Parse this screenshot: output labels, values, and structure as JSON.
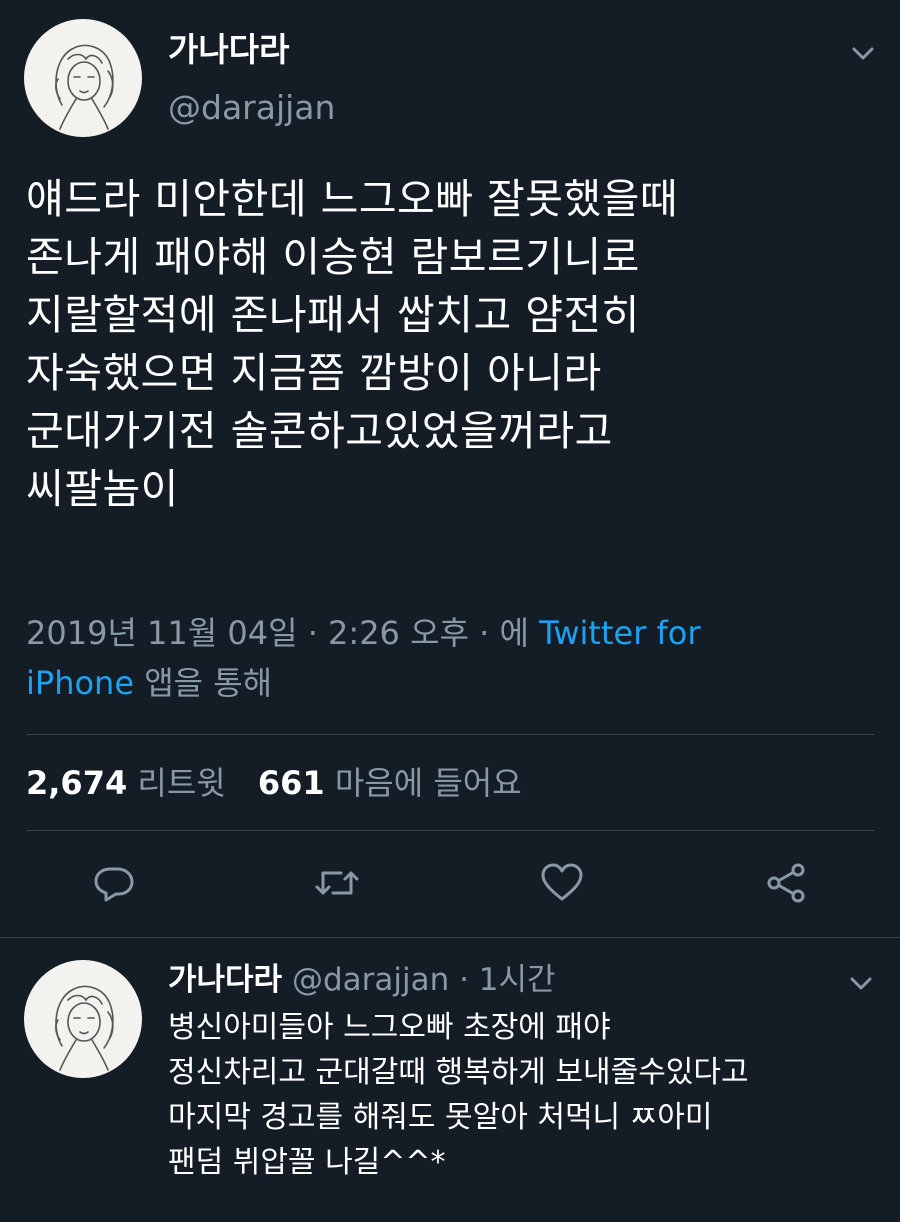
{
  "main_tweet": {
    "display_name": "가나다라",
    "handle": "@darajjan",
    "text": "얘드라 미안한데 느그오빠 잘못했을때\n존나게 패야해 이승현 람보르기니로\n지랄할적에 존나패서 쌉치고 얌전히\n자숙했으면 지금쯤 깜방이 아니라\n군대가기전 솔콘하고있었을꺼라고\n씨팔놈이",
    "meta_prefix": "2019년 11월 04일 · 2:26 오후 · 에 ",
    "source_line1": "Twitter for",
    "source_line2": "iPhone",
    "meta_suffix": " 앱을 통해",
    "retweet_count": "2,674",
    "retweet_label": "리트윗",
    "like_count": "661",
    "like_label": "마음에 들어요"
  },
  "reply": {
    "display_name": "가나다라",
    "handle_time": "@darajjan · 1시간",
    "text": "병신아미들아 느그오빠 초장에 패야\n정신차리고 군대갈때 행복하게 보내줄수있다고\n마지막 경고를 해줘도 못알아 처먹니 ㅉ아미\n팬덤 뷔압꼴 나길^^*"
  },
  "icons": {
    "reply": "reply-icon",
    "retweet": "retweet-icon",
    "like": "heart-icon",
    "share": "share-icon",
    "menu": "chevron-down-icon"
  },
  "colors": {
    "background": "#141d26",
    "text": "#ffffff",
    "muted": "#8899a6",
    "link": "#1da1f2",
    "divider": "#38444d"
  }
}
